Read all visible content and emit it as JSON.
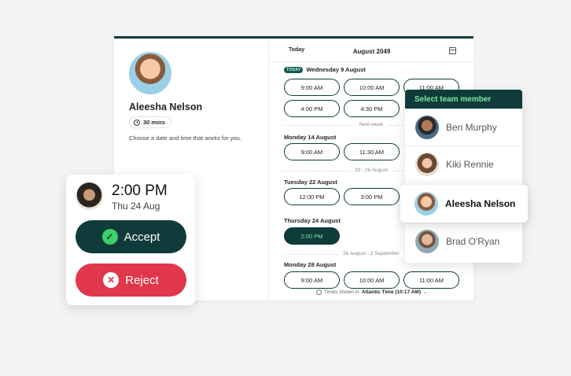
{
  "host": {
    "name": "Aleesha Nelson",
    "duration": "30 mins",
    "instructions": "Choose a date and time that works for you."
  },
  "calendar": {
    "today_label": "Today",
    "month": "August 2049",
    "today_badge": "TODAY",
    "days": [
      {
        "label": "Wednesday 9 August",
        "slots": [
          "9:00 AM",
          "10:00 AM",
          "11:00 AM",
          "4:00 PM",
          "4:30 PM"
        ]
      },
      {
        "label": "Monday 14 August",
        "slots": [
          "9:00 AM",
          "11:30 AM"
        ]
      },
      {
        "label": "Tuesday 22 August",
        "slots": [
          "12:00 PM",
          "3:00 PM"
        ]
      },
      {
        "label": "Thursday 24 August",
        "slots": [
          "2:00 PM"
        ]
      },
      {
        "label": "Monday 28 August",
        "slots": [
          "9:00 AM",
          "10:00 AM",
          "11:00 AM"
        ]
      }
    ],
    "separators": [
      "Next week",
      "20 - 26 August",
      "26 August - 2 September"
    ],
    "timezone_prefix": "Times shown in",
    "timezone": "Atlantic Time (10:17 AM)"
  },
  "team": {
    "header": "Select team member",
    "members": [
      "Ben Murphy",
      "Kiki Rennie",
      "Aleesha Nelson",
      "Brad O'Ryan"
    ],
    "selected": "Aleesha Nelson"
  },
  "booking": {
    "time": "2:00 PM",
    "date": "Thu 24 Aug",
    "accept_label": "Accept",
    "reject_label": "Reject"
  },
  "colors": {
    "brand_dark": "#0f3b3a",
    "accent_green": "#7fe7a4",
    "reject_red": "#e0374b"
  }
}
